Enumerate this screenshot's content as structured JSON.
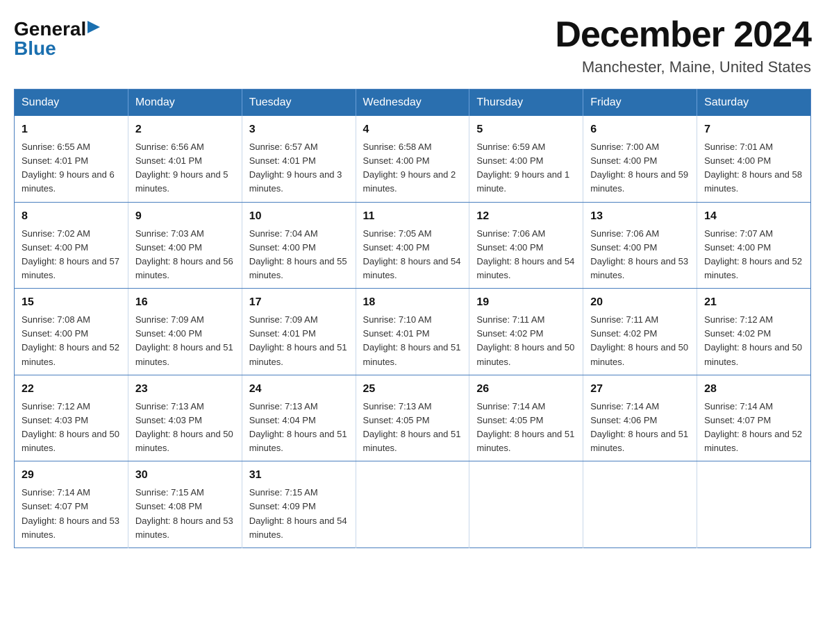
{
  "logo": {
    "line1": "General",
    "triangle": "▶",
    "line2": "Blue"
  },
  "title": "December 2024",
  "location": "Manchester, Maine, United States",
  "days_of_week": [
    "Sunday",
    "Monday",
    "Tuesday",
    "Wednesday",
    "Thursday",
    "Friday",
    "Saturday"
  ],
  "weeks": [
    [
      {
        "day": "1",
        "sunrise": "6:55 AM",
        "sunset": "4:01 PM",
        "daylight": "9 hours and 6 minutes."
      },
      {
        "day": "2",
        "sunrise": "6:56 AM",
        "sunset": "4:01 PM",
        "daylight": "9 hours and 5 minutes."
      },
      {
        "day": "3",
        "sunrise": "6:57 AM",
        "sunset": "4:01 PM",
        "daylight": "9 hours and 3 minutes."
      },
      {
        "day": "4",
        "sunrise": "6:58 AM",
        "sunset": "4:00 PM",
        "daylight": "9 hours and 2 minutes."
      },
      {
        "day": "5",
        "sunrise": "6:59 AM",
        "sunset": "4:00 PM",
        "daylight": "9 hours and 1 minute."
      },
      {
        "day": "6",
        "sunrise": "7:00 AM",
        "sunset": "4:00 PM",
        "daylight": "8 hours and 59 minutes."
      },
      {
        "day": "7",
        "sunrise": "7:01 AM",
        "sunset": "4:00 PM",
        "daylight": "8 hours and 58 minutes."
      }
    ],
    [
      {
        "day": "8",
        "sunrise": "7:02 AM",
        "sunset": "4:00 PM",
        "daylight": "8 hours and 57 minutes."
      },
      {
        "day": "9",
        "sunrise": "7:03 AM",
        "sunset": "4:00 PM",
        "daylight": "8 hours and 56 minutes."
      },
      {
        "day": "10",
        "sunrise": "7:04 AM",
        "sunset": "4:00 PM",
        "daylight": "8 hours and 55 minutes."
      },
      {
        "day": "11",
        "sunrise": "7:05 AM",
        "sunset": "4:00 PM",
        "daylight": "8 hours and 54 minutes."
      },
      {
        "day": "12",
        "sunrise": "7:06 AM",
        "sunset": "4:00 PM",
        "daylight": "8 hours and 54 minutes."
      },
      {
        "day": "13",
        "sunrise": "7:06 AM",
        "sunset": "4:00 PM",
        "daylight": "8 hours and 53 minutes."
      },
      {
        "day": "14",
        "sunrise": "7:07 AM",
        "sunset": "4:00 PM",
        "daylight": "8 hours and 52 minutes."
      }
    ],
    [
      {
        "day": "15",
        "sunrise": "7:08 AM",
        "sunset": "4:00 PM",
        "daylight": "8 hours and 52 minutes."
      },
      {
        "day": "16",
        "sunrise": "7:09 AM",
        "sunset": "4:00 PM",
        "daylight": "8 hours and 51 minutes."
      },
      {
        "day": "17",
        "sunrise": "7:09 AM",
        "sunset": "4:01 PM",
        "daylight": "8 hours and 51 minutes."
      },
      {
        "day": "18",
        "sunrise": "7:10 AM",
        "sunset": "4:01 PM",
        "daylight": "8 hours and 51 minutes."
      },
      {
        "day": "19",
        "sunrise": "7:11 AM",
        "sunset": "4:02 PM",
        "daylight": "8 hours and 50 minutes."
      },
      {
        "day": "20",
        "sunrise": "7:11 AM",
        "sunset": "4:02 PM",
        "daylight": "8 hours and 50 minutes."
      },
      {
        "day": "21",
        "sunrise": "7:12 AM",
        "sunset": "4:02 PM",
        "daylight": "8 hours and 50 minutes."
      }
    ],
    [
      {
        "day": "22",
        "sunrise": "7:12 AM",
        "sunset": "4:03 PM",
        "daylight": "8 hours and 50 minutes."
      },
      {
        "day": "23",
        "sunrise": "7:13 AM",
        "sunset": "4:03 PM",
        "daylight": "8 hours and 50 minutes."
      },
      {
        "day": "24",
        "sunrise": "7:13 AM",
        "sunset": "4:04 PM",
        "daylight": "8 hours and 51 minutes."
      },
      {
        "day": "25",
        "sunrise": "7:13 AM",
        "sunset": "4:05 PM",
        "daylight": "8 hours and 51 minutes."
      },
      {
        "day": "26",
        "sunrise": "7:14 AM",
        "sunset": "4:05 PM",
        "daylight": "8 hours and 51 minutes."
      },
      {
        "day": "27",
        "sunrise": "7:14 AM",
        "sunset": "4:06 PM",
        "daylight": "8 hours and 51 minutes."
      },
      {
        "day": "28",
        "sunrise": "7:14 AM",
        "sunset": "4:07 PM",
        "daylight": "8 hours and 52 minutes."
      }
    ],
    [
      {
        "day": "29",
        "sunrise": "7:14 AM",
        "sunset": "4:07 PM",
        "daylight": "8 hours and 53 minutes."
      },
      {
        "day": "30",
        "sunrise": "7:15 AM",
        "sunset": "4:08 PM",
        "daylight": "8 hours and 53 minutes."
      },
      {
        "day": "31",
        "sunrise": "7:15 AM",
        "sunset": "4:09 PM",
        "daylight": "8 hours and 54 minutes."
      },
      null,
      null,
      null,
      null
    ]
  ]
}
